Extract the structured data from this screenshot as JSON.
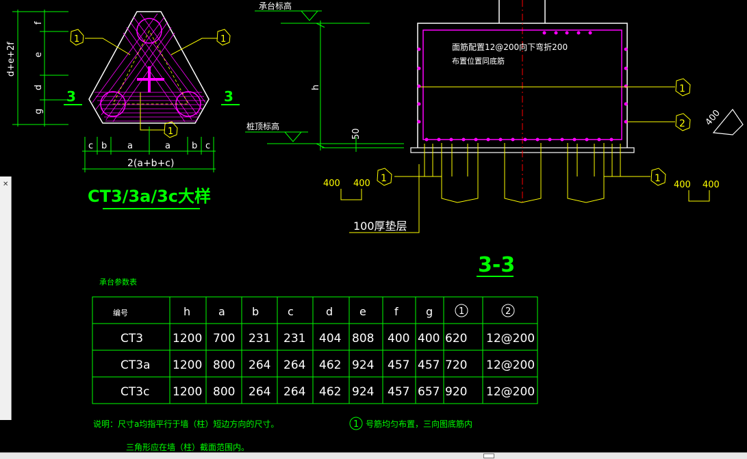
{
  "detail": {
    "title": "CT3/3a/3c大样",
    "section_mark": "3",
    "dim_labels": {
      "f": "f",
      "e": "e",
      "d": "d",
      "g": "g",
      "total": "d+e+2f"
    },
    "bottom_dims": [
      "c",
      "b",
      "a",
      "a",
      "b",
      "c"
    ],
    "bottom_total": "2(a+b+c)",
    "callout_1": "1"
  },
  "section": {
    "title": "3-3",
    "cap_top_label": "承台标高",
    "pile_top_label": "桩顶标高",
    "h_label": "h",
    "dim_50": "50",
    "rebar_note_1": "面筋配置12@200向下弯折200",
    "rebar_note_2": "布置位置同底筋",
    "callout_1": "1",
    "callout_2": "2",
    "left_dims": [
      "400",
      "400"
    ],
    "right_dims": [
      "400",
      "400"
    ],
    "cushion_label": "100厚垫层",
    "hex_label": "400"
  },
  "table": {
    "caption": "承台参数表",
    "headers": [
      "编号",
      "h",
      "a",
      "b",
      "c",
      "d",
      "e",
      "f",
      "g",
      "1",
      "2"
    ],
    "rows": [
      [
        "CT3",
        "1200",
        "700",
        "231",
        "231",
        "404",
        "808",
        "400",
        "400",
        "620",
        "12@200"
      ],
      [
        "CT3a",
        "1200",
        "800",
        "264",
        "264",
        "462",
        "924",
        "457",
        "457",
        "720",
        "12@200"
      ],
      [
        "CT3c",
        "1200",
        "800",
        "264",
        "264",
        "462",
        "924",
        "457",
        "657",
        "920",
        "12@200"
      ]
    ]
  },
  "notes": {
    "note1": "说明：尺寸a均指平行于墙（柱）短边方向的尺寸。",
    "note2": "三角形应在墙（柱）截面范围内。",
    "note3_num": "1",
    "note3": "号筋均匀布置，三向图底筋内"
  },
  "colors": {
    "background": "#000000",
    "green": "#00ff00",
    "white": "#ffffff",
    "magenta": "#ff00ff",
    "yellow": "#ffff00",
    "red": "#ff0000"
  }
}
